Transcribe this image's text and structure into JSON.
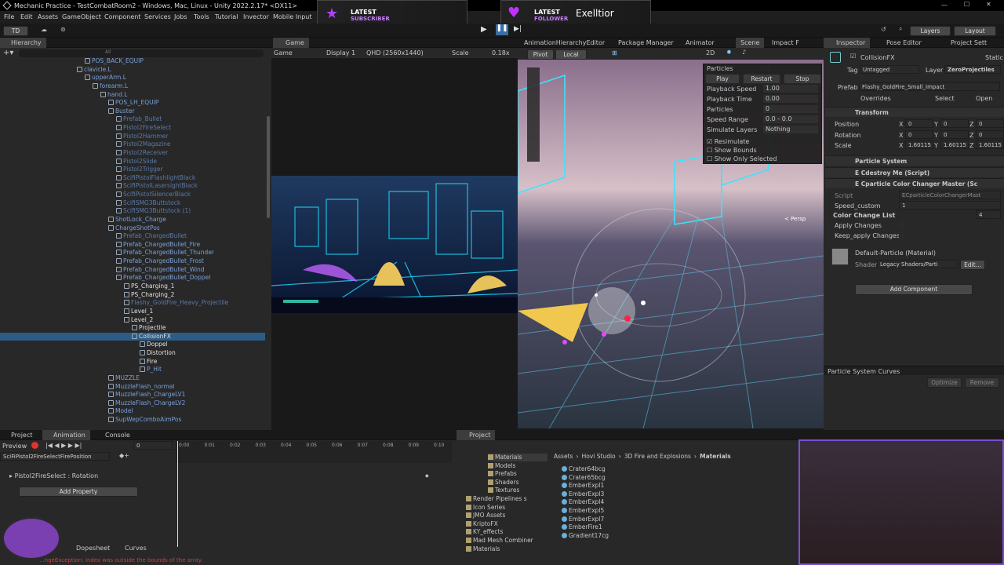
{
  "window": {
    "title": "Mechanic Practice - TestCombatRoom2 - Windows, Mac, Linux - Unity 2022.2.17* <DX11>"
  },
  "menu": [
    "File",
    "Edit",
    "Assets",
    "GameObject",
    "Component",
    "Services",
    "Jobs",
    "Tools",
    "Tutorial",
    "Invector",
    "Mobile Input"
  ],
  "stream": {
    "alert1_title": "LATEST",
    "alert1_sub": "SUBSCRIBER",
    "alert2_title": "LATEST",
    "alert2_sub": "FOLLOWER",
    "follower_name": "Exelltior"
  },
  "toolbar": {
    "account": "TD",
    "layers": "Layers",
    "layout": "Layout"
  },
  "hierarchy": {
    "tab": "Hierarchy",
    "search_prefix": "All",
    "items": [
      {
        "label": "POS_BACK_EQUIP",
        "d": 11,
        "c": "blue"
      },
      {
        "label": "clavicle.L",
        "d": 10,
        "c": "blue"
      },
      {
        "label": "upperArm.L",
        "d": 11,
        "c": "blue"
      },
      {
        "label": "forearm.L",
        "d": 12,
        "c": "blue"
      },
      {
        "label": "hand.L",
        "d": 13,
        "c": "blue"
      },
      {
        "label": "POS_LH_EQUIP",
        "d": 14,
        "c": "blue"
      },
      {
        "label": "Buster",
        "d": 14,
        "c": "blue"
      },
      {
        "label": "Prefab_Bullet",
        "d": 15,
        "c": "faint"
      },
      {
        "label": "Pistol2FireSelect",
        "d": 15,
        "c": "faint"
      },
      {
        "label": "Pistol2Hammer",
        "d": 15,
        "c": "faint"
      },
      {
        "label": "Pistol2Magazine",
        "d": 15,
        "c": "faint"
      },
      {
        "label": "Pistol2Receiver",
        "d": 15,
        "c": "faint"
      },
      {
        "label": "Pistol2Slide",
        "d": 15,
        "c": "faint"
      },
      {
        "label": "Pistol2Trigger",
        "d": 15,
        "c": "faint"
      },
      {
        "label": "ScifiPistolFlashlightBlack",
        "d": 15,
        "c": "faint"
      },
      {
        "label": "ScifiPistolLasersightBlack",
        "d": 15,
        "c": "faint"
      },
      {
        "label": "ScifiPistolSilencerBlack",
        "d": 15,
        "c": "faint"
      },
      {
        "label": "ScifiSMG3Buttstock",
        "d": 15,
        "c": "faint"
      },
      {
        "label": "ScifiSMG3Buttstock (1)",
        "d": 15,
        "c": "faint"
      },
      {
        "label": "ShotLock_Charge",
        "d": 14,
        "c": "blue"
      },
      {
        "label": "ChargeShotPos",
        "d": 14,
        "c": "blue"
      },
      {
        "label": "Prefab_ChargedBullet",
        "d": 15,
        "c": "faint"
      },
      {
        "label": "Prefab_ChargedBullet_Fire",
        "d": 15,
        "c": "blue"
      },
      {
        "label": "Prefab_ChargedBullet_Thunder",
        "d": 15,
        "c": "blue"
      },
      {
        "label": "Prefab_ChargedBullet_Frost",
        "d": 15,
        "c": "blue"
      },
      {
        "label": "Prefab_ChargedBullet_Wind",
        "d": 15,
        "c": "blue"
      },
      {
        "label": "Prefab_ChargedBullet_Doppel",
        "d": 15,
        "c": "blue"
      },
      {
        "label": "PS_Charging_1",
        "d": 16,
        "c": "white"
      },
      {
        "label": "PS_Charging_2",
        "d": 16,
        "c": "white"
      },
      {
        "label": "Flashy_GoldFire_Heavy_Projectile",
        "d": 16,
        "c": "faint"
      },
      {
        "label": "Level_1",
        "d": 16,
        "c": "white"
      },
      {
        "label": "Level_2",
        "d": 16,
        "c": "white"
      },
      {
        "label": "Projectile",
        "d": 17,
        "c": "white"
      },
      {
        "label": "CollisionFX",
        "d": 17,
        "c": "selected"
      },
      {
        "label": "Doppel",
        "d": 18,
        "c": "white"
      },
      {
        "label": "Distortion",
        "d": 18,
        "c": "white"
      },
      {
        "label": "Fire",
        "d": 18,
        "c": "white"
      },
      {
        "label": "P_Hit",
        "d": 18,
        "c": "blue"
      },
      {
        "label": "MUZZLE",
        "d": 14,
        "c": "blue"
      },
      {
        "label": "MuzzleFlash_normal",
        "d": 14,
        "c": "blue"
      },
      {
        "label": "MuzzleFlash_ChargeLV1",
        "d": 14,
        "c": "blue"
      },
      {
        "label": "MuzzleFlash_ChargeLV2",
        "d": 14,
        "c": "blue"
      },
      {
        "label": "Model",
        "d": 14,
        "c": "blue"
      },
      {
        "label": "SupWepComboAimPos",
        "d": 14,
        "c": "blue"
      }
    ]
  },
  "game": {
    "tab": "Game",
    "mode": "Game",
    "display": "Display 1",
    "resolution": "QHD (2560x1440)",
    "scale_label": "Scale",
    "scale_value": "0.18x"
  },
  "scene_tabs": [
    "AnimationHierarchyEditor",
    "Package Manager",
    "Animator",
    "Scene",
    "Impact F"
  ],
  "scene": {
    "pivot": "Pivot",
    "local": "Local",
    "persp": "< Persp",
    "two_d": "2D"
  },
  "particles_overlay": {
    "title": "Particles",
    "play": "Play",
    "restart": "Restart",
    "stop": "Stop",
    "rows": [
      {
        "k": "Playback Speed",
        "v": "1.00"
      },
      {
        "k": "Playback Time",
        "v": "0.00"
      },
      {
        "k": "Particles",
        "v": "0"
      },
      {
        "k": "Speed Range",
        "v": "0.0 - 0.0"
      },
      {
        "k": "Simulate Layers",
        "v": "Nothing"
      }
    ],
    "resimulate": "Resimulate",
    "show_bounds": "Show Bounds",
    "show_only_selected": "Show Only Selected"
  },
  "inspector": {
    "tabs": [
      "Inspector",
      "Pose Editor",
      "Project Sett"
    ],
    "object_name": "CollisionFX",
    "static": "Static",
    "tag_label": "Tag",
    "tag": "Untagged",
    "layer_label": "Layer",
    "layer": "ZeroProjectiles",
    "prefab_label": "Prefab",
    "prefab": "Flashy_GoldFire_Small_Impact",
    "overrides": "Overrides",
    "select": "Select",
    "open": "Open",
    "transform": "Transform",
    "position": "Position",
    "rotation": "Rotation",
    "scale": "Scale",
    "pos": [
      "0",
      "0",
      "0"
    ],
    "rot": [
      "0",
      "0",
      "0"
    ],
    "scl": [
      "1.60115",
      "1.60115",
      "1.60115"
    ],
    "components": [
      "Particle System",
      "E Cdestroy Me (Script)",
      "E Cparticle Color Changer Master (Sc"
    ],
    "script_label": "Script",
    "script": "ECparticleColorChangerMast",
    "speed_custom": "Speed_custom",
    "speed_value": "1",
    "color_change_list": "Color Change List",
    "color_count": "4",
    "apply_changes": "Apply Changes",
    "keep_apply": "Keep_apply Changes",
    "material": "Default-Particle (Material)",
    "shader_label": "Shader",
    "shader": "Legacy Shaders/Parti",
    "edit": "Edit...",
    "add_component": "Add Component",
    "curves": "Particle System Curves",
    "optimize": "Optimize",
    "remove": "Remove"
  },
  "animation": {
    "tabs": [
      "Project",
      "Animation",
      "Console"
    ],
    "preview": "Preview",
    "frame": "0",
    "clip": "SciFiPistol2FireSelectFirePosition",
    "property": "Pistol2FireSelect : Rotation",
    "add_property": "Add Property",
    "dopesheet": "Dopesheet",
    "curves": "Curves",
    "ticks": [
      "0:00",
      "0:01",
      "0:02",
      "0:03",
      "0:04",
      "0:05",
      "0:06",
      "0:07",
      "0:08",
      "0:09",
      "0:10"
    ],
    "error": "...ngeException: Index was outside the bounds of the array."
  },
  "project": {
    "tab": "Project",
    "folders": [
      "Materials",
      "Models",
      "Prefabs",
      "Shaders",
      "Textures",
      "Render Pipelines s",
      "Icon Series",
      "JMO Assets",
      "KriptoFX",
      "KY_effects",
      "Mad Mesh Combiner",
      "Materials"
    ],
    "breadcrumb": [
      "Assets",
      "Hovl Studio",
      "3D Fire and Explosions",
      "Materials"
    ],
    "files": [
      "Crater64bcg",
      "Crater65bcg",
      "EmberExpl1",
      "EmberExpl3",
      "EmberExpl4",
      "EmberExpl5",
      "EmberExpl7",
      "EmberFire1",
      "Gradient17cg"
    ]
  },
  "colors": {
    "accent": "#2c5d87",
    "panel": "#282828",
    "purple": "#a020f0"
  }
}
